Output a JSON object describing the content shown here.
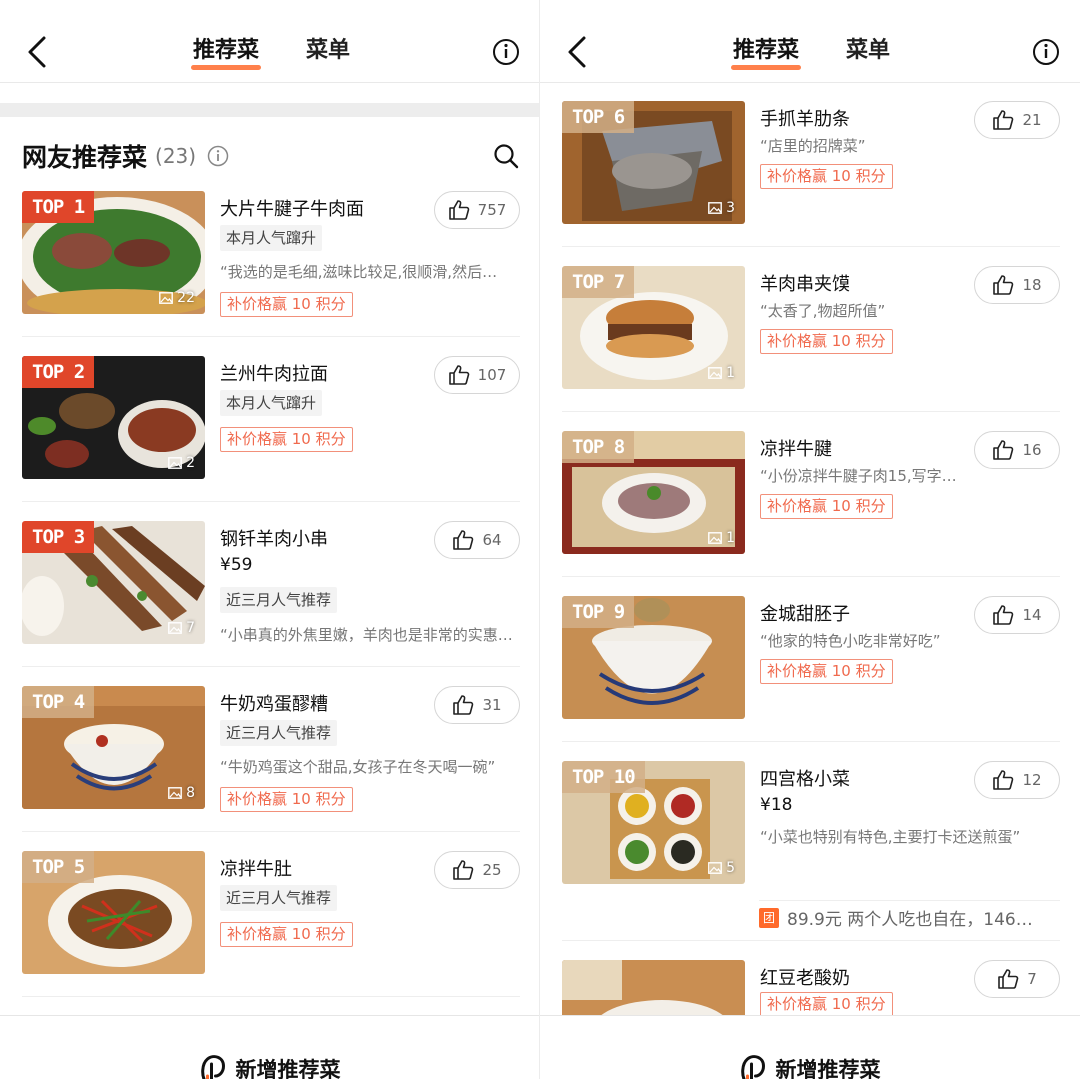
{
  "nav": {
    "tab_recommend": "推荐菜",
    "tab_menu": "菜单"
  },
  "section": {
    "title": "网友推荐菜",
    "count": "(23)"
  },
  "left_dishes": [
    {
      "rank": "TOP 1",
      "name": "大片牛腱子牛肉面",
      "tag": "本月人气蹿升",
      "quote": "“我选的是毛细,滋味比较足,很顺滑,然后…",
      "points": "补价格赢 10 积分",
      "photos": "22",
      "likes": "757"
    },
    {
      "rank": "TOP 2",
      "name": "兰州牛肉拉面",
      "tag": "本月人气蹿升",
      "points": "补价格赢 10 积分",
      "photos": "2",
      "likes": "107"
    },
    {
      "rank": "TOP 3",
      "name": "钢钎羊肉小串",
      "price": "¥59",
      "tag": "近三月人气推荐",
      "quote": "“小串真的外焦里嫩，羊肉也是非常的实惠,…",
      "photos": "7",
      "likes": "64"
    },
    {
      "rank": "TOP 4",
      "name": "牛奶鸡蛋醪糟",
      "tag": "近三月人气推荐",
      "quote": "“牛奶鸡蛋这个甜品,女孩子在冬天喝一碗”",
      "points": "补价格赢 10 积分",
      "photos": "8",
      "likes": "31"
    },
    {
      "rank": "TOP 5",
      "name": "凉拌牛肚",
      "tag": "近三月人气推荐",
      "points": "补价格赢 10 积分",
      "likes": "25"
    }
  ],
  "right_dishes": [
    {
      "rank": "TOP 6",
      "name": "手抓羊肋条",
      "quote": "“店里的招牌菜”",
      "points": "补价格赢 10 积分",
      "photos": "3",
      "likes": "21"
    },
    {
      "rank": "TOP 7",
      "name": "羊肉串夹馍",
      "quote": "“太香了,物超所值”",
      "points": "补价格赢 10 积分",
      "photos": "1",
      "likes": "18"
    },
    {
      "rank": "TOP 8",
      "name": "凉拌牛腱",
      "quote": "“小份凉拌牛腱子肉15,写字…",
      "points": "补价格赢 10 积分",
      "photos": "1",
      "likes": "16"
    },
    {
      "rank": "TOP 9",
      "name": "金城甜胚子",
      "quote": "“他家的特色小吃非常好吃”",
      "points": "补价格赢 10 积分",
      "likes": "14"
    },
    {
      "rank": "TOP 10",
      "name": "四宫格小菜",
      "price": "¥18",
      "quote": "“小菜也特别有特色,主要打卡还送煎蛋”",
      "photos": "5",
      "likes": "12"
    },
    {
      "name": "红豆老酸奶",
      "points": "补价格赢 10 积分",
      "likes": "7"
    }
  ],
  "deal": {
    "icon": "团",
    "text": "89.9元 两个人吃也自在，146…"
  },
  "bottom": {
    "add_label": "新增推荐菜"
  },
  "colors": {
    "accent": "#ff6a2b",
    "top_badge_hot": "#e0462a",
    "points_border": "#f2907a"
  }
}
